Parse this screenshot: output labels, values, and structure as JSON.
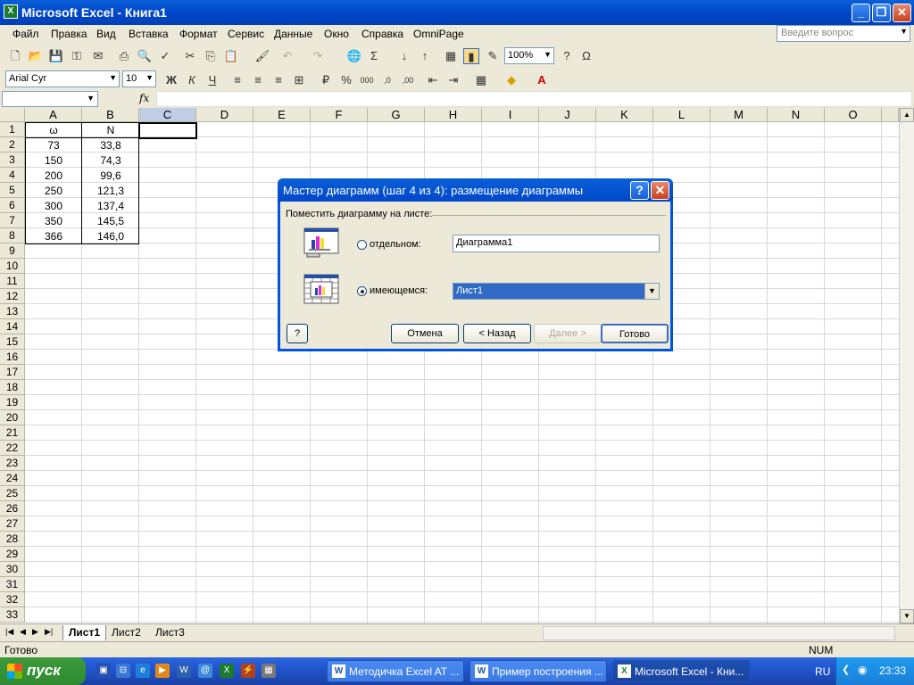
{
  "window": {
    "title": "Microsoft Excel - Книга1",
    "app_icon": "excel-icon"
  },
  "menu": [
    "Файл",
    "Правка",
    "Вид",
    "Вставка",
    "Формат",
    "Сервис",
    "Данные",
    "Окно",
    "Справка",
    "OmniPage"
  ],
  "help_search": {
    "placeholder": "Введите вопрос"
  },
  "toolbar": {
    "zoom": "100%",
    "font": "Arial Cyr",
    "font_size": "10"
  },
  "formula_bar": {
    "name_box": "",
    "fx": "fx",
    "content": ""
  },
  "columns": [
    "A",
    "B",
    "C",
    "D",
    "E",
    "F",
    "G",
    "H",
    "I",
    "J",
    "K",
    "L",
    "M",
    "N",
    "O"
  ],
  "rows": [
    "1",
    "2",
    "3",
    "4",
    "5",
    "6",
    "7",
    "8",
    "9",
    "10",
    "11",
    "12",
    "13",
    "14",
    "15",
    "16",
    "17",
    "18",
    "19",
    "20",
    "21",
    "22",
    "23",
    "24",
    "25",
    "26",
    "27",
    "28",
    "29",
    "30",
    "31",
    "32",
    "33"
  ],
  "cells": {
    "a1": "ω",
    "b1": "N",
    "a2": "73",
    "b2": "33,8",
    "a3": "150",
    "b3": "74,3",
    "a4": "200",
    "b4": "99,6",
    "a5": "250",
    "b5": "121,3",
    "a6": "300",
    "b6": "137,4",
    "a7": "350",
    "b7": "145,5",
    "a8": "366",
    "b8": "146,0"
  },
  "sheet_tabs": [
    "Лист1",
    "Лист2",
    "Лист3"
  ],
  "active_sheet": "Лист1",
  "status": {
    "left": "Готово",
    "num": "NUM"
  },
  "dialog": {
    "title": "Мастер диаграмм (шаг 4 из 4): размещение диаграммы",
    "group_label": "Поместить диаграмму на листе:",
    "option_separate": "отдельном:",
    "separate_value": "Диаграмма1",
    "option_existing": "имеющемся:",
    "existing_value": "Лист1",
    "selected_option": "имеющемся",
    "btn_cancel": "Отмена",
    "btn_back": "< Назад",
    "btn_next": "Далее >",
    "btn_finish": "Готово"
  },
  "taskbar": {
    "start": "пуск",
    "tasks": [
      "Методичка Excel AT ...",
      "Пример построения ...",
      "Microsoft Excel - Кни..."
    ],
    "lang": "RU",
    "clock": "23:33"
  }
}
